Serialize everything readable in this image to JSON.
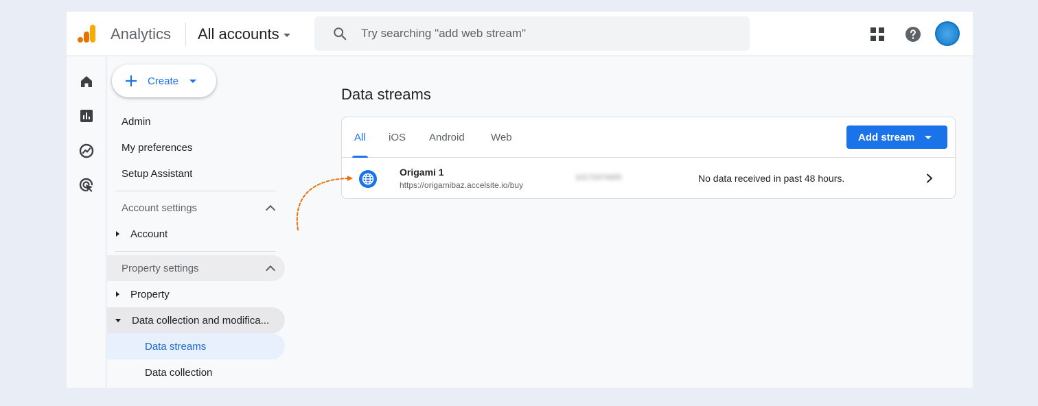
{
  "topbar": {
    "app_name": "Analytics",
    "account_picker": "All accounts",
    "search_placeholder": "Try searching \"add web stream\""
  },
  "rail": {
    "icons": [
      "home-icon",
      "reports-icon",
      "explore-icon",
      "advertising-icon"
    ]
  },
  "nav": {
    "create_label": "Create",
    "items": {
      "admin": "Admin",
      "my_preferences": "My preferences",
      "setup_assistant": "Setup Assistant",
      "account_settings": "Account settings",
      "account": "Account",
      "property_settings": "Property settings",
      "property": "Property",
      "data_collection_mod": "Data collection and modifica...",
      "data_streams": "Data streams",
      "data_collection": "Data collection"
    }
  },
  "main": {
    "title": "Data streams",
    "tabs": [
      "All",
      "iOS",
      "Android",
      "Web"
    ],
    "active_tab": "All",
    "add_stream_label": "Add stream",
    "streams": [
      {
        "name": "Origami 1",
        "url": "https://origamibaz.accelsite.io/buy",
        "stream_id": "10172474405",
        "status": "No data received in past 48 hours."
      }
    ]
  },
  "colors": {
    "accent": "#1a73e8",
    "logo_orange": "#f9ab00",
    "logo_dark_orange": "#e37400",
    "annotation": "#e8710a"
  }
}
